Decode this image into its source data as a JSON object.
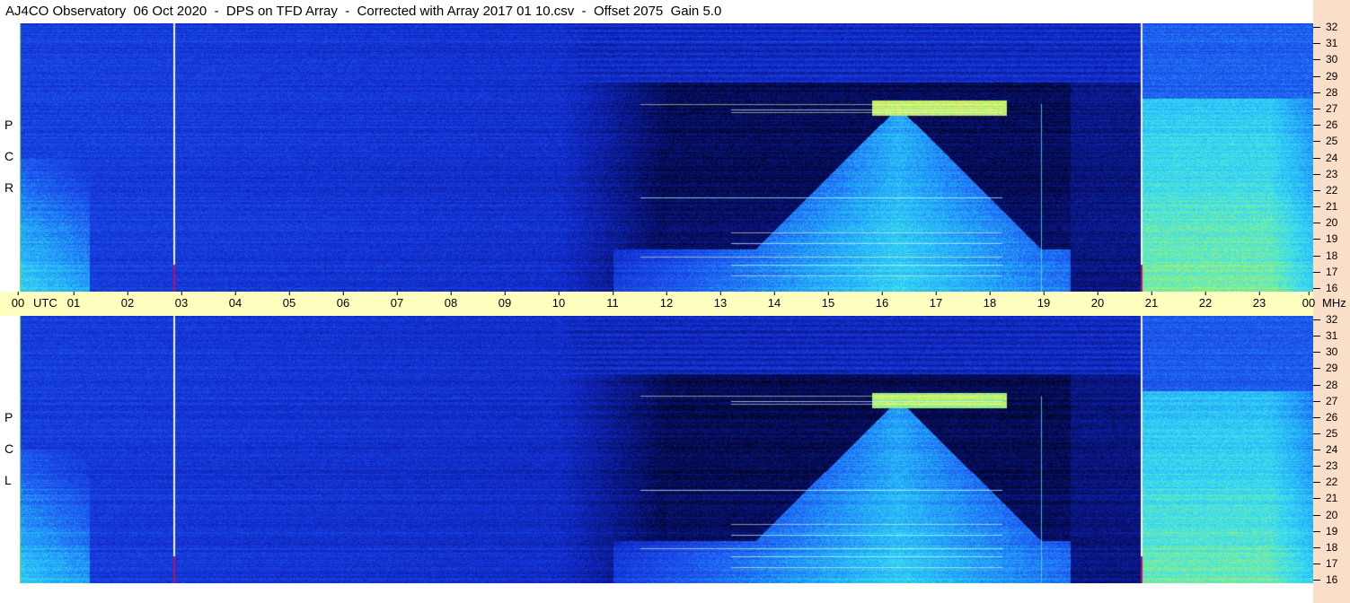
{
  "header": {
    "title": "AJ4CO Observatory  06 Oct 2020  -  DPS on TFD Array  -  Corrected with Array 2017 01 10.csv  -  Offset 2075  Gain 5.0"
  },
  "panels": [
    {
      "name": "rcp",
      "letters": [
        "P",
        "C",
        "R"
      ]
    },
    {
      "name": "lcp",
      "letters": [
        "P",
        "C",
        "L"
      ]
    }
  ],
  "axes": {
    "utc_label": "UTC",
    "mhz_label": "MHz",
    "time_ticks": [
      "00",
      "01",
      "02",
      "03",
      "04",
      "05",
      "06",
      "07",
      "08",
      "09",
      "10",
      "11",
      "12",
      "13",
      "14",
      "15",
      "16",
      "17",
      "18",
      "19",
      "20",
      "21",
      "22",
      "23",
      "00"
    ],
    "freq_ticks": [
      "32",
      "31",
      "30",
      "29",
      "28",
      "27",
      "26",
      "25",
      "24",
      "23",
      "22",
      "21",
      "20",
      "19",
      "18",
      "17",
      "16"
    ]
  },
  "colors": {
    "background_dark": "#000000",
    "quiet_blue": "#1f3fe0",
    "burst_cyan": "#30d0ff",
    "hot_yellow": "#f0f060",
    "time_axis_bg": "#ffffc0",
    "freq_axis_bg": "#f9dfc8"
  },
  "chart_data": {
    "type": "heatmap",
    "title": "AJ4CO Observatory  06 Oct 2020  -  DPS on TFD Array  -  Corrected with Array 2017 01 10.csv  -  Offset 2075  Gain 5.0",
    "xlabel": "UTC",
    "ylabel": "MHz",
    "xlim": [
      0,
      24
    ],
    "ylim": [
      16,
      32
    ],
    "series": [
      {
        "name": "R C P"
      },
      {
        "name": "L C P"
      }
    ],
    "features": [
      {
        "kind": "vertical_line",
        "utc_hours": 2.85
      },
      {
        "kind": "vertical_line",
        "utc_hours": 20.8
      },
      {
        "kind": "broadband_emission",
        "utc_start": 11.0,
        "utc_end": 19.5,
        "freq_low": 16,
        "freq_high": 27.5
      },
      {
        "kind": "broadband_emission",
        "utc_start": 20.8,
        "utc_end": 24.0,
        "freq_low": 16,
        "freq_high": 28
      },
      {
        "kind": "broadband_emission",
        "utc_start": 0.0,
        "utc_end": 1.2,
        "freq_low": 16,
        "freq_high": 24
      }
    ]
  }
}
